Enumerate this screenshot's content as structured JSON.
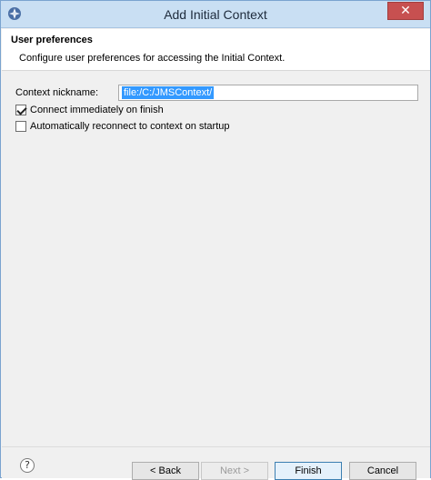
{
  "window": {
    "title": "Add Initial Context",
    "close_label": "✕"
  },
  "header": {
    "title": "User preferences",
    "description": "Configure user preferences for accessing the Initial Context."
  },
  "form": {
    "nickname_label": "Context nickname:",
    "nickname_value": "file:/C:/JMSContext/",
    "connect_immediately": {
      "label": "Connect immediately on finish",
      "checked": true
    },
    "auto_reconnect": {
      "label": "Automatically reconnect to context on startup",
      "checked": false
    }
  },
  "footer": {
    "help_label": "?",
    "back_label": "< Back",
    "next_label": "Next >",
    "finish_label": "Finish",
    "cancel_label": "Cancel"
  }
}
